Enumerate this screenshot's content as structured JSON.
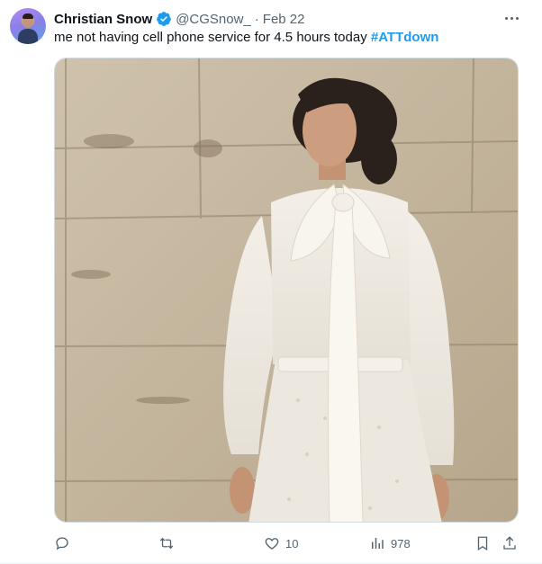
{
  "tweet": {
    "author_name": "Christian Snow",
    "handle": "@CGSnow_",
    "separator": "·",
    "date": "Feb 22",
    "text": "me not having cell phone service for 4.5 hours today ",
    "hashtag": "#ATTdown",
    "verified": true
  },
  "media": {
    "subject": "photo of a woman in a white blouse with a large bow and white skirt against a weathered wooden wall"
  },
  "actions": {
    "reply_count": "",
    "repost_count": "",
    "like_count": "10",
    "views_count": "978"
  },
  "colors": {
    "accent": "#1d9bf0",
    "secondary_text": "#536471",
    "primary_text": "#0f1419"
  },
  "icons": {
    "verified": "verified-badge-icon",
    "more": "more-horizontal-icon",
    "reply": "reply-icon",
    "repost": "repost-icon",
    "like": "heart-icon",
    "views": "views-chart-icon",
    "bookmark": "bookmark-icon",
    "share": "share-icon"
  }
}
